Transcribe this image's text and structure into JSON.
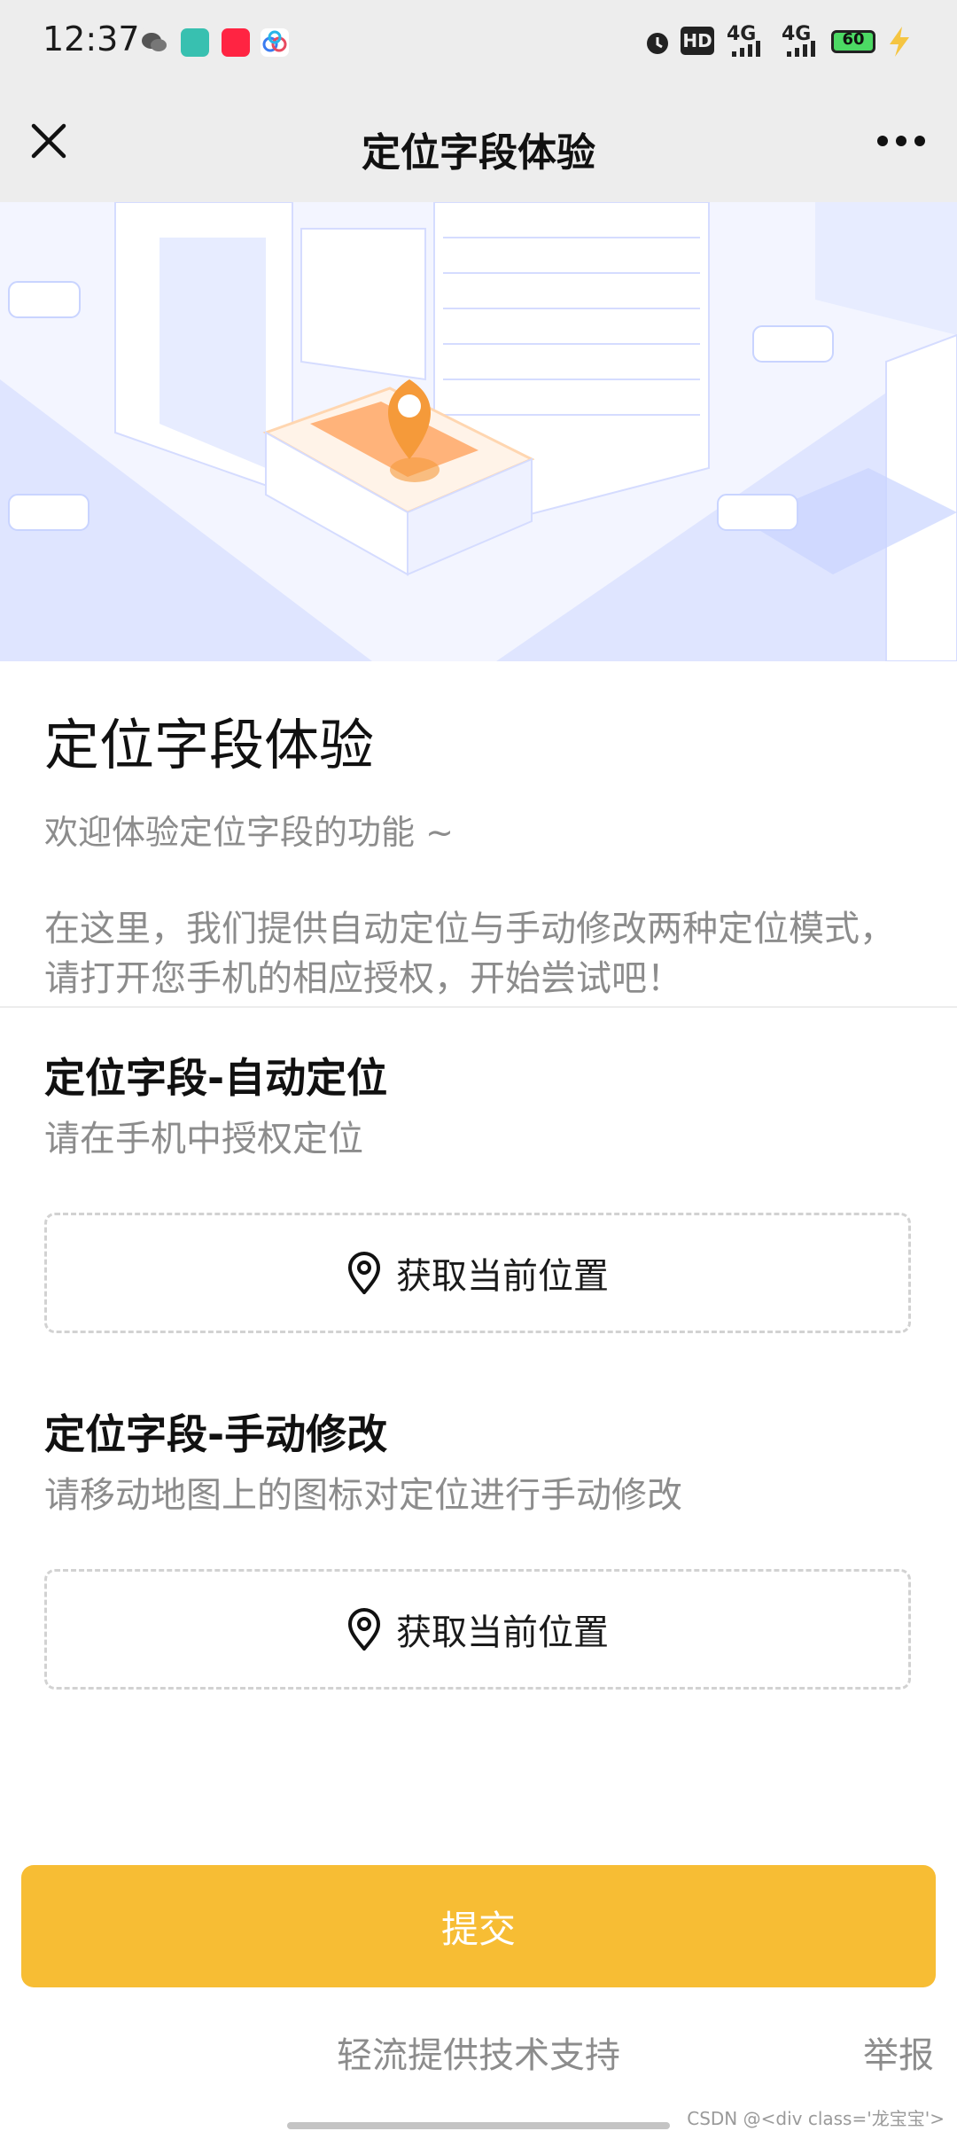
{
  "status_bar": {
    "time": "12:37",
    "network1": "4G",
    "network2": "4G",
    "battery": "60",
    "hd": "HD",
    "icons": [
      "wechat-icon",
      "boss-app-icon",
      "xiaohongshu-icon",
      "baidu-netdisk-icon",
      "alarm-icon",
      "hd-icon",
      "signal-icon",
      "signal-icon",
      "battery-icon",
      "charging-icon"
    ]
  },
  "nav": {
    "title": "定位字段体验",
    "icons": [
      "close-icon",
      "more-icon"
    ]
  },
  "form": {
    "title": "定位字段体验",
    "desc_line1": "欢迎体验定位字段的功能 ~",
    "desc_line2": "在这里，我们提供自动定位与手动修改两种定位模式，请打开您手机的相应授权，开始尝试吧！"
  },
  "fields": [
    {
      "label": "定位字段-自动定位",
      "hint": "请在手机中授权定位",
      "button": "获取当前位置"
    },
    {
      "label": "定位字段-手动修改",
      "hint": "请移动地图上的图标对定位进行手动修改",
      "button": "获取当前位置"
    }
  ],
  "submit_label": "提交",
  "footer": {
    "support": "轻流提供技术支持",
    "report": "举报",
    "watermark": "CSDN @<div class='龙宝宝'>"
  },
  "colors": {
    "accent": "#f7bd34",
    "navbar_bg": "#ededed",
    "hint_text": "#8c8c8c",
    "banner_blue": "#c9d4ff",
    "pin_orange": "#f59a3a"
  }
}
